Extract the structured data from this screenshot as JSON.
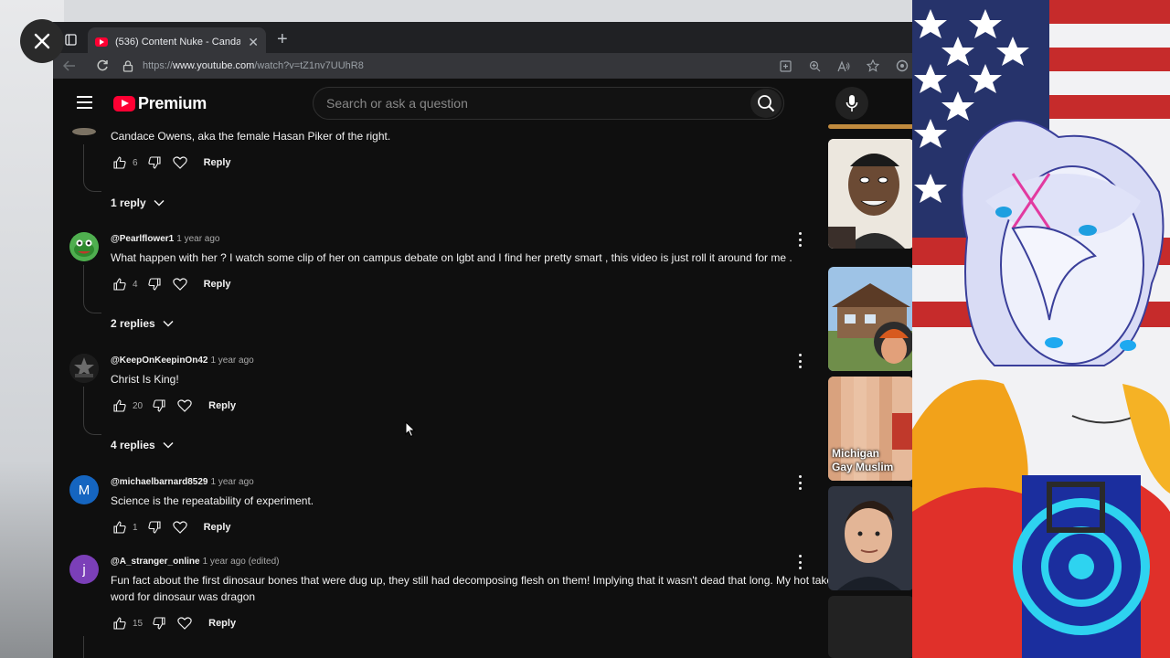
{
  "browser": {
    "tab_title": "(536) Content Nuke - Candace O",
    "url_prefix": "https://",
    "url_domain": "www.youtube.com",
    "url_path": "/watch?v=tZ1nv7UUhR8"
  },
  "youtube": {
    "logo_text": "Premium",
    "search_placeholder": "Search or ask a question"
  },
  "comments": [
    {
      "handle": "",
      "time": "",
      "text": "Candace Owens, aka the female Hasan Piker of the right.",
      "likes": "6",
      "reply_label": "Reply",
      "replies_label": "1 reply"
    },
    {
      "handle": "@Pearlflower1",
      "time": "1 year ago",
      "text": "What happen with her ? I watch some clip of her on campus debate on lgbt and I find her pretty smart , this video is just roll it around for me .",
      "likes": "4",
      "reply_label": "Reply",
      "replies_label": "2 replies"
    },
    {
      "handle": "@KeepOnKeepinOn42",
      "time": "1 year ago",
      "text": "Christ Is King!",
      "likes": "20",
      "reply_label": "Reply",
      "replies_label": "4 replies"
    },
    {
      "handle": "@michaelbarnard8529",
      "time": "1 year ago",
      "text": "Science is the repeatability of experiment.",
      "likes": "1",
      "reply_label": "Reply",
      "avatar_letter": "M",
      "avatar_color": "#1565c0"
    },
    {
      "handle": "@A_stranger_online",
      "time": "1 year ago (edited)",
      "text": "Fun fact about the first dinosaur bones that were dug up, they still had decomposing flesh on them! Implying that it wasn't dead that long. My hot take, the old world word for dinosaur was dragon",
      "likes": "15",
      "reply_label": "Reply",
      "avatar_letter": "j",
      "avatar_color": "#7b3fb8"
    }
  ],
  "side_thumbnails": [
    {
      "caption": ""
    },
    {
      "caption": ""
    },
    {
      "caption_line1": "Michigan",
      "caption_line2": "Gay Muslim"
    },
    {
      "caption": ""
    }
  ]
}
